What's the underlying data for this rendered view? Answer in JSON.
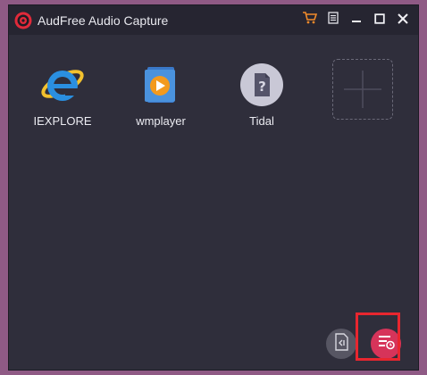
{
  "window": {
    "title": "AudFree Audio Capture",
    "accent": "#e0325a",
    "background": "#2f2e3b"
  },
  "titlebar_buttons": [
    {
      "icon": "cart-icon"
    },
    {
      "icon": "menu-icon"
    },
    {
      "icon": "minimize-icon"
    },
    {
      "icon": "maximize-icon"
    },
    {
      "icon": "close-icon"
    }
  ],
  "apps": [
    {
      "label": "IEXPLORE",
      "icon": "internet-explorer-icon"
    },
    {
      "label": "wmplayer",
      "icon": "windows-media-player-icon"
    },
    {
      "label": "Tidal",
      "icon": "unknown-app-icon"
    }
  ],
  "add_app": {
    "icon": "plus-icon"
  },
  "bottom_buttons": [
    {
      "icon": "audio-file-icon"
    },
    {
      "icon": "capture-history-icon"
    }
  ]
}
